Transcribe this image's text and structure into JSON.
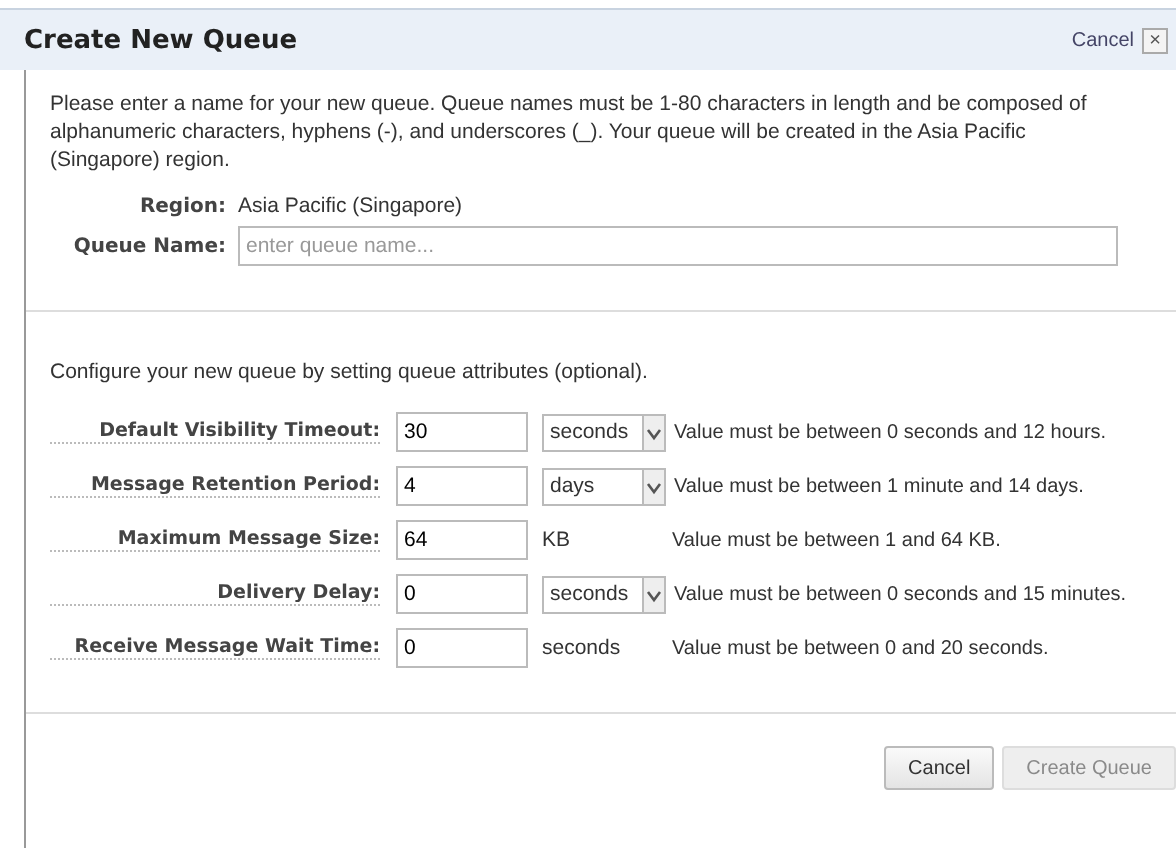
{
  "dialog": {
    "title": "Create New Queue",
    "close_label": "Cancel",
    "close_icon": "×"
  },
  "intro": "Please enter a name for your new queue. Queue names must be 1-80 characters in length and be composed of alphanumeric characters, hyphens (-), and underscores (_). Your queue will be created in the Asia Pacific (Singapore) region.",
  "region": {
    "label": "Region:",
    "value": "Asia Pacific (Singapore)"
  },
  "queue_name": {
    "label": "Queue Name:",
    "placeholder": "enter queue name..."
  },
  "attributes_intro": "Configure your new queue by setting queue attributes (optional).",
  "attributes": [
    {
      "label": "Default Visibility Timeout:",
      "value": "30",
      "kind": "select",
      "unit": "seconds",
      "hint": "Value must be between 0 seconds and 12 hours."
    },
    {
      "label": "Message Retention Period:",
      "value": "4",
      "kind": "select",
      "unit": "days",
      "hint": "Value must be between 1 minute and 14 days."
    },
    {
      "label": "Maximum Message Size:",
      "value": "64",
      "kind": "text",
      "unit": "KB",
      "hint": "Value must be between 1 and 64 KB."
    },
    {
      "label": "Delivery Delay:",
      "value": "0",
      "kind": "select",
      "unit": "seconds",
      "hint": "Value must be between 0 seconds and 15 minutes."
    },
    {
      "label": "Receive Message Wait Time:",
      "value": "0",
      "kind": "text",
      "unit": "seconds",
      "hint": "Value must be between 0 and 20 seconds."
    }
  ],
  "buttons": [
    {
      "label": "Cancel",
      "disabled": false
    },
    {
      "label": "Create Queue",
      "disabled": true
    }
  ]
}
